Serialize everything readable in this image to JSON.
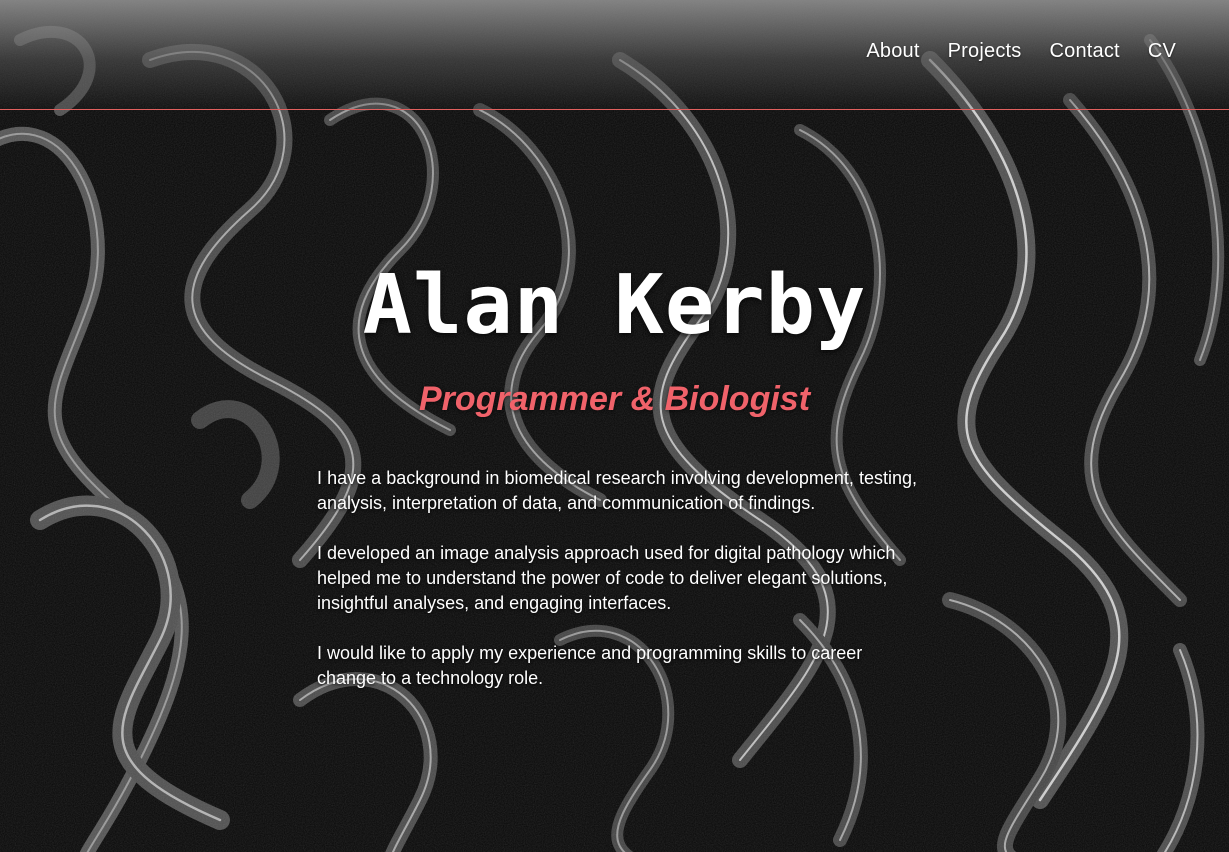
{
  "nav": {
    "items": [
      {
        "label": "About"
      },
      {
        "label": "Projects"
      },
      {
        "label": "Contact"
      },
      {
        "label": "CV"
      }
    ]
  },
  "hero": {
    "name": "Alan Kerby",
    "tagline": "Programmer & Biologist"
  },
  "bio": {
    "paragraphs": [
      "I have a background in biomedical research involving development, testing, analysis, interpretation of data, and communication of findings.",
      "I developed an image analysis approach used for digital pathology which helped me to understand the power of code to deliver elegant solutions, insightful analyses, and engaging interfaces.",
      "I would like to apply my experience and programming skills to career change to a technology role."
    ]
  },
  "colors": {
    "accent": "#f0626a",
    "header_rule": "#e0605e",
    "text": "#ffffff",
    "background": "#080808"
  }
}
